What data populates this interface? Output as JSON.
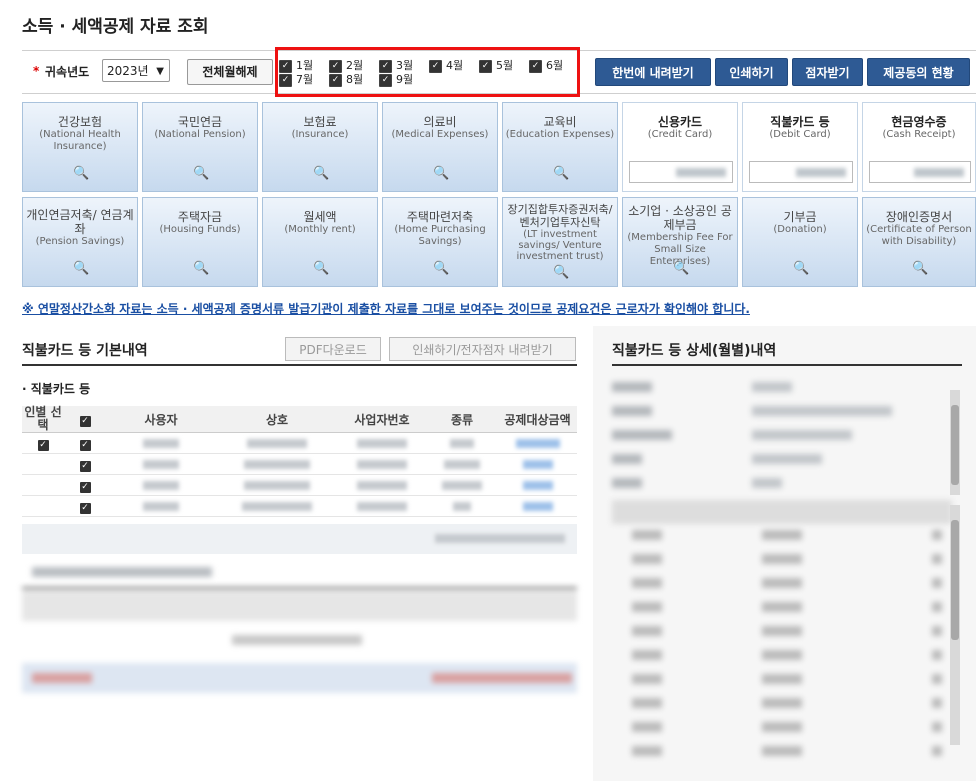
{
  "page": {
    "title": "소득 · 세액공제 자료 조회"
  },
  "filter": {
    "required_mark": "*",
    "year_label": "귀속년도",
    "year_value": "2023년",
    "toggle_all_label": "전체월해제",
    "months": [
      "1월",
      "2월",
      "3월",
      "4월",
      "5월",
      "6월",
      "7월",
      "8월",
      "9월"
    ],
    "actions": [
      "한번에 내려받기",
      "인쇄하기",
      "점자받기",
      "제공동의 현황"
    ]
  },
  "categories": [
    {
      "ko": "건강보험",
      "en": "(National Health Insurance)"
    },
    {
      "ko": "국민연금",
      "en": "(National Pension)"
    },
    {
      "ko": "보험료",
      "en": "(Insurance)"
    },
    {
      "ko": "의료비",
      "en": "(Medical Expenses)"
    },
    {
      "ko": "교육비",
      "en": "(Education Expenses)"
    },
    {
      "ko": "신용카드",
      "en": "(Credit Card)"
    },
    {
      "ko": "직불카드 등",
      "en": "(Debit Card)"
    },
    {
      "ko": "현금영수증",
      "en": "(Cash Receipt)"
    },
    {
      "ko": "개인연금저축/ 연금계좌",
      "en": "(Pension Savings)"
    },
    {
      "ko": "주택자금",
      "en": "(Housing Funds)"
    },
    {
      "ko": "월세액",
      "en": "(Monthly rent)"
    },
    {
      "ko": "주택마련저축",
      "en": "(Home Purchasing Savings)"
    },
    {
      "ko": "장기집합투자증권저축/ 벤처기업투자신탁",
      "en": "(LT investment savings/ Venture investment trust)"
    },
    {
      "ko": "소기업 · 소상공인 공제부금",
      "en": "(Membership Fee For Small Size Enterprises)"
    },
    {
      "ko": "기부금",
      "en": "(Donation)"
    },
    {
      "ko": "장애인증명서",
      "en": "(Certificate of Person with Disability)"
    }
  ],
  "notice": "※ 연말정산간소화 자료는 소득 · 세액공제 증명서류 발급기관이 제출한 자료를 그대로 보여주는 것이므로 공제요건은 근로자가 확인해야 합니다.",
  "left": {
    "title": "직불카드 등 기본내역",
    "pdf_button": "PDF다운로드",
    "print_button": "인쇄하기/전자점자 내려받기",
    "subsection": "직불카드 등",
    "columns": [
      "인별 선택",
      "",
      "사용자",
      "상호",
      "사업자번호",
      "종류",
      "공제대상금액"
    ]
  },
  "right": {
    "title": "직불카드 등 상세(월별)내역"
  },
  "colors": {
    "accent": "#2e5a94",
    "highlight": "#e11111",
    "link": "#1a4fa3"
  }
}
